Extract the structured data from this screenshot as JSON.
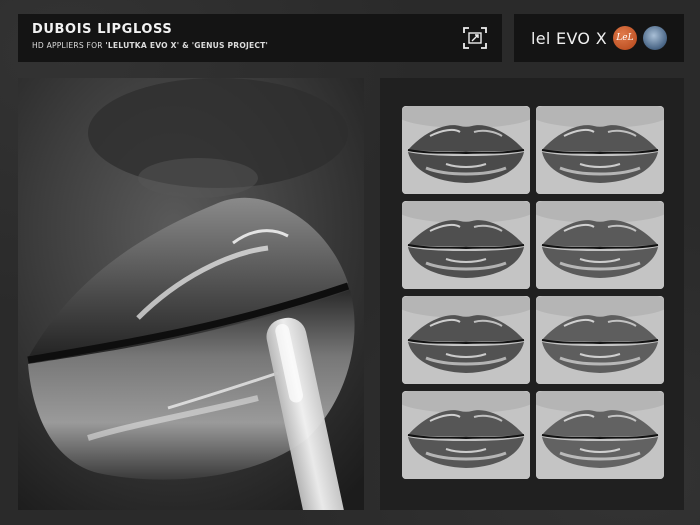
{
  "header": {
    "title": "DUBOIS LIPGLOSS",
    "subtitle_prefix": "HD APPLIERS FOR ",
    "subtitle_names": "'LELUTKA EVO X' & 'GENUS PROJECT'",
    "hd_icon": "hd-expand-icon"
  },
  "brand": {
    "text": "lel EVO X",
    "badges": [
      {
        "name": "lelutka-logo-badge",
        "text": "LeL",
        "color": "#c75a2a"
      },
      {
        "name": "genus-logo-badge",
        "color": "#6b86a6"
      }
    ]
  },
  "swatches": {
    "count": 8,
    "shades": [
      "#4a4a4a",
      "#555555",
      "#4f4f4f",
      "#5a5a5a",
      "#525252",
      "#5e5e5e",
      "#565656",
      "#626262"
    ]
  }
}
